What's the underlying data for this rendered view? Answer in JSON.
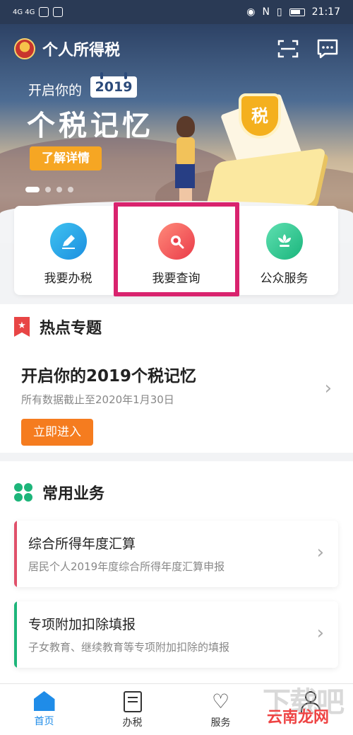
{
  "status_bar": {
    "network_left": "4G 4G",
    "time": "21:17"
  },
  "header": {
    "app_title": "个人所得税",
    "scan_icon": "scan-icon",
    "message_icon": "message-icon"
  },
  "banner": {
    "intro": "开启你的",
    "year": "2019",
    "title": "个税记忆",
    "button": "了解详情",
    "shield_text": "税",
    "slide_count": 4,
    "active_slide": 1
  },
  "quick_actions": [
    {
      "label": "我要办税",
      "icon": "edit-icon",
      "color": "#1c8fe0"
    },
    {
      "label": "我要查询",
      "icon": "search-icon",
      "color": "#ea3b49"
    },
    {
      "label": "公众服务",
      "icon": "flower-icon",
      "color": "#1ab57c"
    }
  ],
  "hot": {
    "section_title": "热点专题",
    "card_title": "开启你的2019个税记忆",
    "card_subtitle": "所有数据截止至2020年1月30日",
    "button": "立即进入"
  },
  "common": {
    "section_title": "常用业务",
    "items": [
      {
        "title": "综合所得年度汇算",
        "subtitle": "居民个人2019年度综合所得年度汇算申报",
        "accent": "#e0506a"
      },
      {
        "title": "专项附加扣除填报",
        "subtitle": "子女教育、继续教育等专项附加扣除的填报",
        "accent": "#1db57a"
      }
    ]
  },
  "tabs": [
    {
      "label": "首页",
      "active": true
    },
    {
      "label": "办税",
      "active": false
    },
    {
      "label": "服务",
      "active": false
    },
    {
      "label": "",
      "active": false
    }
  ],
  "watermark": {
    "text": "云南龙网",
    "faint_text": "下载吧"
  },
  "colors": {
    "highlight_frame": "#d9236e",
    "primary": "#1f8ce8",
    "orange": "#f57c1f"
  }
}
